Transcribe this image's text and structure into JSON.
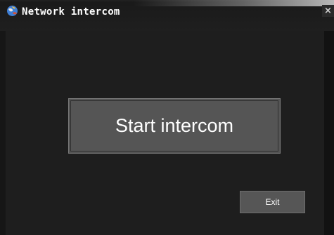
{
  "window": {
    "title": "Network intercom",
    "app_icon": "app-globe-icon",
    "close_icon": "close-icon",
    "close_glyph": "×"
  },
  "main": {
    "start_button_label": "Start intercom",
    "exit_button_label": "Exit"
  },
  "colors": {
    "background": "#1e1e1e",
    "button_fill": "#555555",
    "button_border": "#7a7a7a",
    "text": "#ffffff"
  }
}
